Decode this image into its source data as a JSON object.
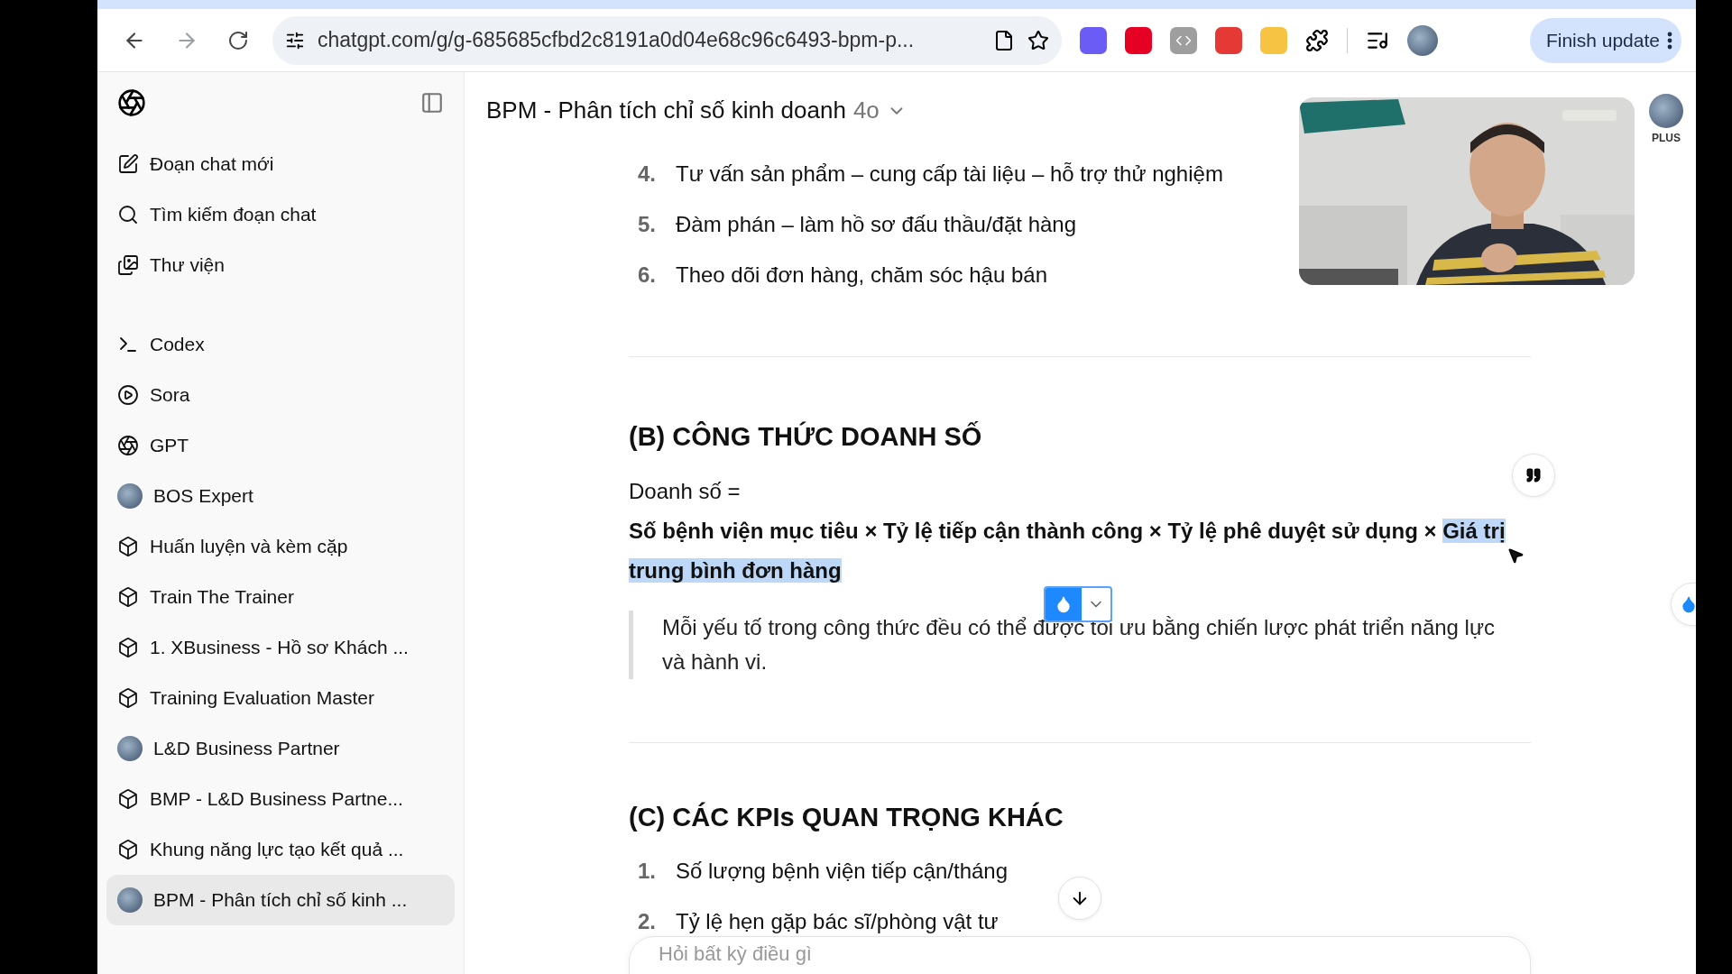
{
  "browser": {
    "url": "chatgpt.com/g/g-685685cfbd2c8191a0d04e68c96c6493-bpm-p...",
    "update_button": "Finish update"
  },
  "sidebar": {
    "items": [
      {
        "kind": "new-chat",
        "label": "Đoạn chat mới",
        "selected": false
      },
      {
        "kind": "search",
        "label": "Tìm kiếm đoạn chat",
        "selected": false
      },
      {
        "kind": "library",
        "label": "Thư viện",
        "selected": false
      },
      {
        "kind": "codex",
        "label": "Codex",
        "selected": false
      },
      {
        "kind": "sora",
        "label": "Sora",
        "selected": false
      },
      {
        "kind": "gpt",
        "label": "GPT",
        "selected": false
      },
      {
        "kind": "avatar",
        "label": "BOS Expert",
        "selected": false
      },
      {
        "kind": "project",
        "label": "Huấn luyện và kèm cặp",
        "selected": false
      },
      {
        "kind": "project",
        "label": "Train The Trainer",
        "selected": false
      },
      {
        "kind": "project",
        "label": "1. XBusiness - Hồ sơ Khách ...",
        "selected": false
      },
      {
        "kind": "project",
        "label": "Training Evaluation Master",
        "selected": false
      },
      {
        "kind": "avatar",
        "label": "L&D Business Partner",
        "selected": false
      },
      {
        "kind": "project",
        "label": "BMP - L&D Business Partne...",
        "selected": false
      },
      {
        "kind": "project",
        "label": "Khung năng lực tạo kết quả ...",
        "selected": false
      },
      {
        "kind": "avatar",
        "label": "BPM - Phân tích chỉ số kinh ...",
        "selected": true
      }
    ]
  },
  "header": {
    "title": "BPM - Phân tích chỉ số kinh doanh",
    "model": "4o",
    "plan": "PLUS"
  },
  "content": {
    "top_list": [
      {
        "number": "4.",
        "text": "Tư vấn sản phẩm – cung cấp tài liệu – hỗ trợ thử nghiệm"
      },
      {
        "number": "5.",
        "text": "Đàm phán – làm hồ sơ đấu thầu/đặt hàng"
      },
      {
        "number": "6.",
        "text": "Theo dõi đơn hàng, chăm sóc hậu bán"
      }
    ],
    "section_b": {
      "heading": "(B) CÔNG THỨC DOANH SỐ",
      "intro": "Doanh số =",
      "formula": [
        {
          "text": "Số bệnh viện mục tiêu × Tỷ lệ tiếp cận thành công × Tỷ lệ phê duyệt sử dụng × ",
          "selected": false
        },
        {
          "text": "Giá trị trung bình đơn hàng",
          "selected": true
        }
      ],
      "quote": "Mỗi yếu tố trong công thức đều có thể được tối ưu bằng chiến lược phát triển năng lực và hành vi."
    },
    "section_c": {
      "heading": "(C) CÁC KPIs QUAN TRỌNG KHÁC",
      "list": [
        {
          "number": "1.",
          "text": "Số lượng bệnh viện tiếp cận/tháng"
        },
        {
          "number": "2.",
          "text": "Tỷ lệ hẹn gặp bác sĩ/phòng vật tư"
        }
      ]
    }
  },
  "composer": {
    "placeholder": "Hỏi bất kỳ điều gì"
  }
}
